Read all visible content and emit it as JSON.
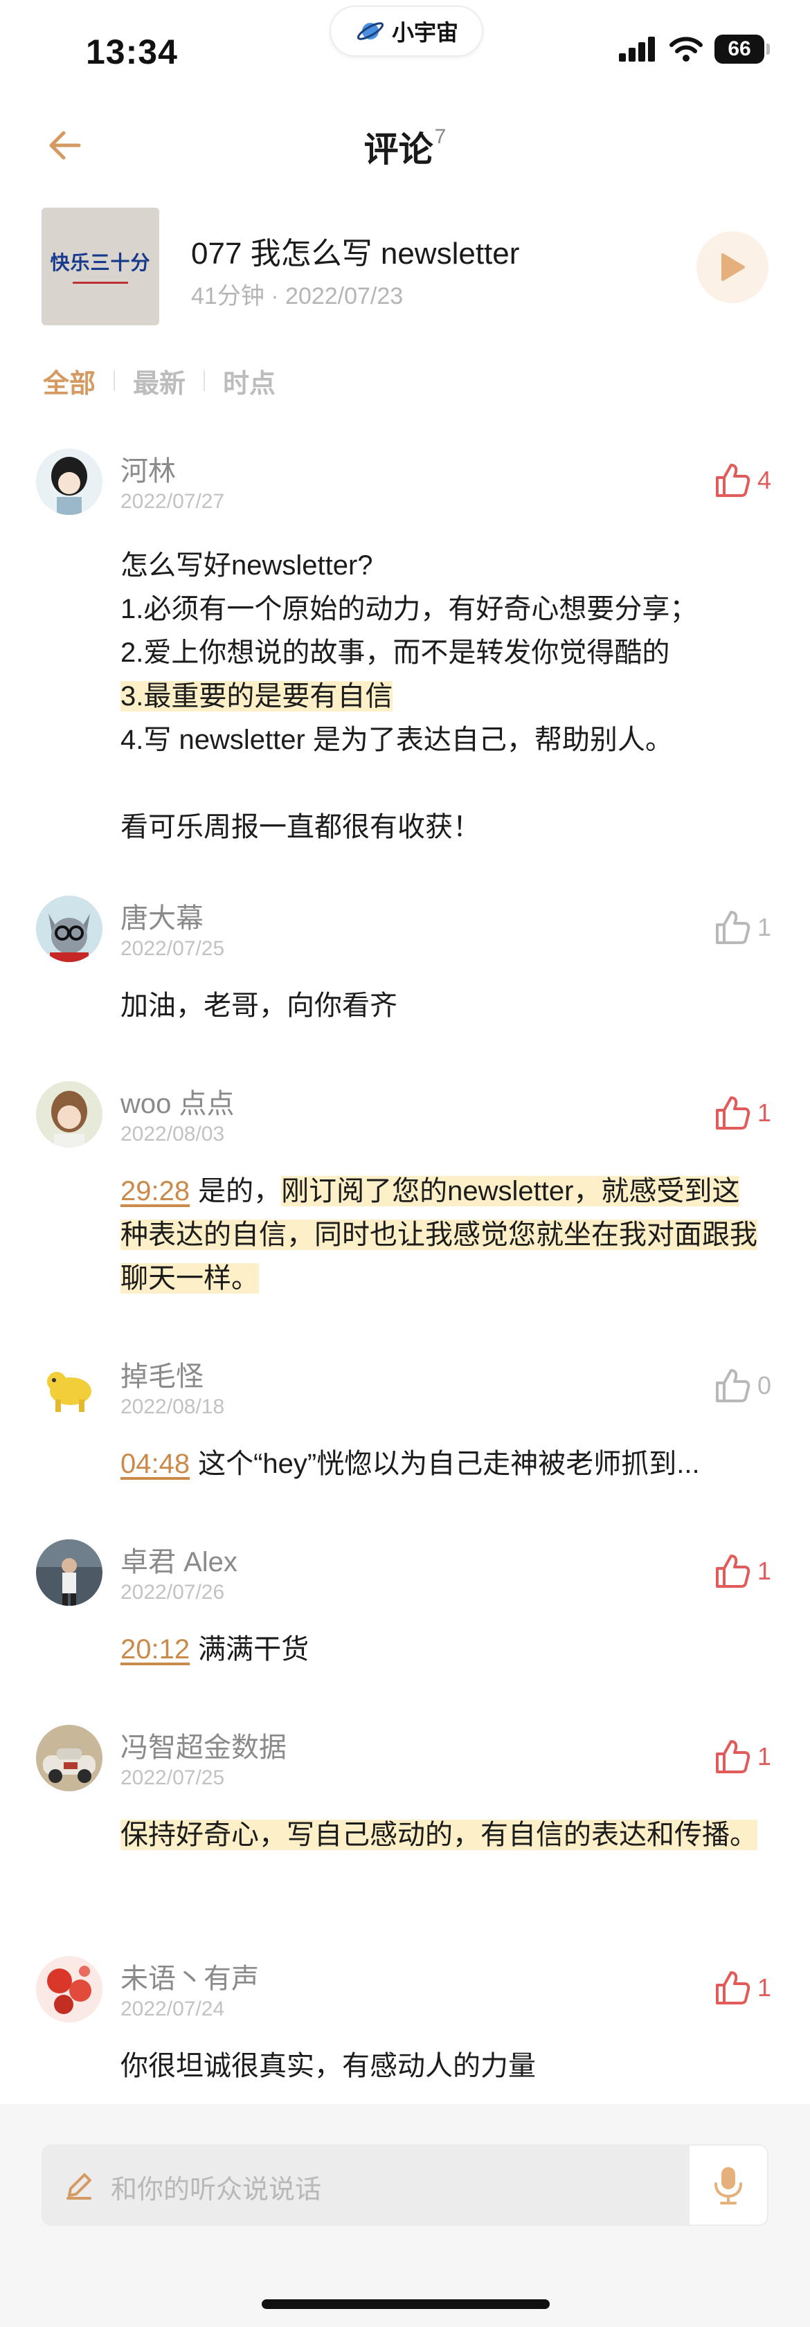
{
  "status_bar": {
    "time": "13:34",
    "app_name": "小宇宙",
    "battery": "66"
  },
  "nav": {
    "title": "评论",
    "count": "7"
  },
  "episode": {
    "cover_text": "快乐三十分",
    "title": "077 我怎么写 newsletter",
    "meta": "41分钟 · 2022/07/23"
  },
  "tabs": [
    {
      "label": "全部",
      "active": true
    },
    {
      "label": "最新",
      "active": false
    },
    {
      "label": "时点",
      "active": false
    }
  ],
  "comments": [
    {
      "name": "河林",
      "date": "2022/07/27",
      "likes": "4",
      "liked": true,
      "lines": [
        "怎么写好newsletter?",
        "1.必须有一个原始的动力，有好奇心想要分享；",
        "2.爱上你想说的故事，而不是转发你觉得酷的",
        "3.最重要的是要有自信",
        "4.写 newsletter 是为了表达自己，帮助别人。",
        "",
        "看可乐周报一直都很有收获！"
      ]
    },
    {
      "name": "唐大幕",
      "date": "2022/07/25",
      "likes": "1",
      "liked": false,
      "text": "加油，老哥，向你看齐"
    },
    {
      "name": "woo 点点",
      "date": "2022/08/03",
      "likes": "1",
      "liked": true,
      "timestamp": "29:28",
      "text_plain": "是的，",
      "text_hl": "刚订阅了您的newsletter，就感受到这种表达的自信，同时也让我感觉您就坐在我对面跟我聊天一样。"
    },
    {
      "name": "掉毛怪",
      "date": "2022/08/18",
      "likes": "0",
      "liked": false,
      "timestamp": "04:48",
      "text": "这个“hey”恍惚以为自己走神被老师抓到..."
    },
    {
      "name": "卓君 Alex",
      "date": "2022/07/26",
      "likes": "1",
      "liked": true,
      "timestamp": "20:12",
      "text": "满满干货"
    },
    {
      "name": "冯智超金数据",
      "date": "2022/07/25",
      "likes": "1",
      "liked": true,
      "text_hl": "保持好奇心，写自己感动的，有自信的表达和传播。"
    },
    {
      "name": "未语丶有声",
      "date": "2022/07/24",
      "likes": "1",
      "liked": true,
      "text": "你很坦诚很真实，有感动人的力量"
    }
  ],
  "input": {
    "placeholder": "和你的听众说说话"
  },
  "colors": {
    "accent": "#d59a62",
    "like_red": "#e25b5b",
    "highlight": "#fdf0c8"
  }
}
